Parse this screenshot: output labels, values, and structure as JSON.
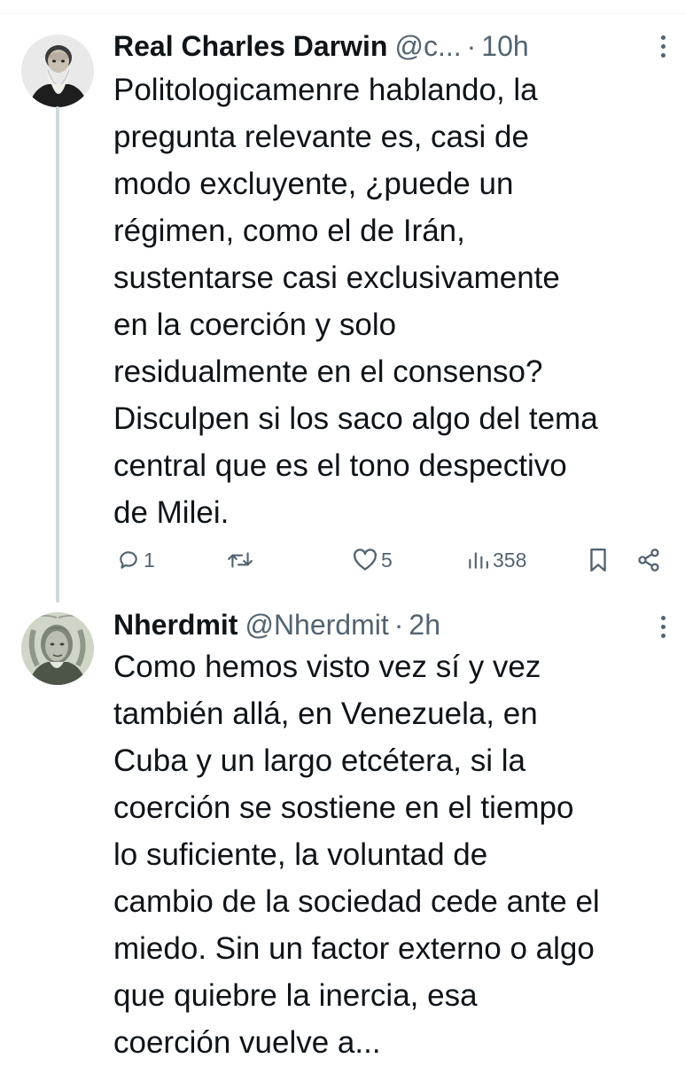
{
  "tweets": [
    {
      "author_name": "Real Charles Darwin",
      "handle": "@c...",
      "separator": "·",
      "time": "10h",
      "avatar_icon": "bearded-man-portrait",
      "lines": [
        "Politologicamenre hablando, la",
        "pregunta relevante es, casi de",
        "modo excluyente, ¿puede un",
        "régimen, como el de Irán,",
        "sustentarse casi exclusivamente",
        "en la coerción y solo",
        "residualmente en el consenso?",
        "Disculpen si los saco algo del tema",
        "central que es el tono despectivo",
        "de Milei."
      ],
      "actions": {
        "reply_count": "1",
        "retweet_count": "",
        "like_count": "5",
        "views_count": "358"
      }
    },
    {
      "author_name": "Nherdmit",
      "handle": "@Nherdmit",
      "separator": "·",
      "time": "2h",
      "avatar_icon": "franklin-banknote-portrait",
      "lines": [
        "Como hemos visto vez sí y vez",
        "también allá, en Venezuela, en",
        "Cuba y un largo etcétera, si la",
        "coerción se sostiene en el tiempo",
        "lo suficiente, la voluntad de",
        "cambio de la sociedad cede ante el",
        "miedo. Sin un factor externo o algo",
        "que quiebre la inercia, esa",
        "coerción vuelve a..."
      ]
    }
  ],
  "colors": {
    "text": "#0f1419",
    "secondary": "#536471",
    "thread_line": "#cfd9de",
    "divider": "#eff3f4"
  }
}
